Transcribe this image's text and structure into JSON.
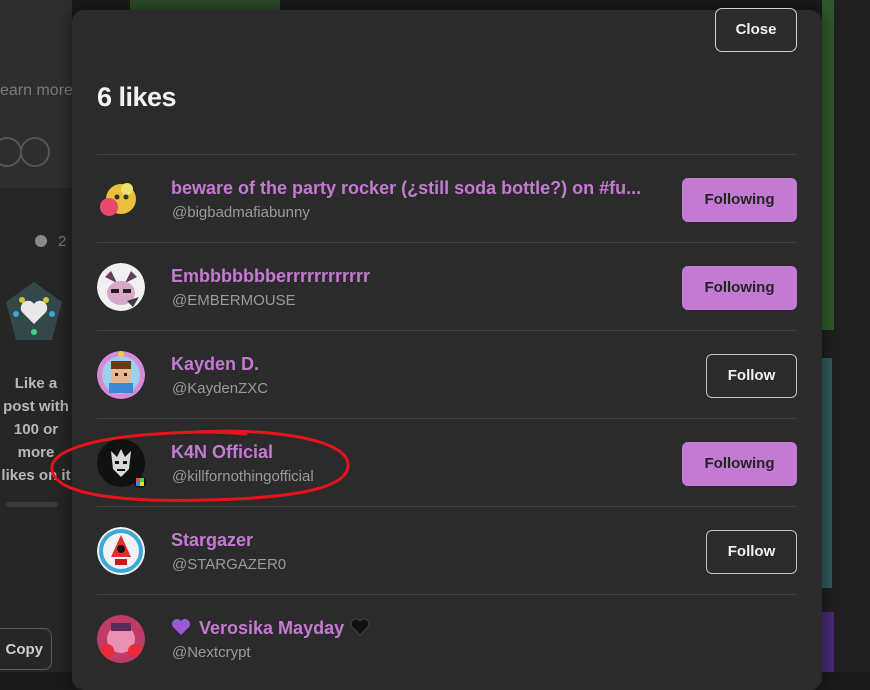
{
  "background": {
    "learn_more": "earn more",
    "clock_text": "2",
    "like_badge_text": "Like a post with 100 or more likes on it",
    "copy_label": "Copy"
  },
  "modal": {
    "close_label": "Close",
    "title": "6 likes",
    "users": [
      {
        "name": "beware of the party rocker (¿still soda bottle?) on #fu...",
        "handle": "@bigbadmafiabunny",
        "button": "Following",
        "state": "following",
        "avatar_color": "#e8c03b"
      },
      {
        "name": "Embbbbbbberrrrrrrrrrrr",
        "handle": "@EMBERMOUSE",
        "button": "Following",
        "state": "following",
        "avatar_color": "#c8a0c0"
      },
      {
        "name": "Kayden D.",
        "handle": "@KaydenZXC",
        "button": "Follow",
        "state": "follow",
        "avatar_color": "#7ab8e8"
      },
      {
        "name": "K4N Official",
        "handle": "@killfornothingofficial",
        "button": "Following",
        "state": "following",
        "avatar_color": "#111111"
      },
      {
        "name": "Stargazer",
        "handle": "@STARGAZER0",
        "button": "Follow",
        "state": "follow",
        "avatar_color": "#3aa8d8"
      },
      {
        "name": "Verosika Mayday",
        "handle": "@Nextcrypt",
        "button": "",
        "state": "",
        "avatar_color": "#c03a6a"
      }
    ]
  },
  "annotation_color": "#e8141c",
  "accent": "#c27ad3"
}
